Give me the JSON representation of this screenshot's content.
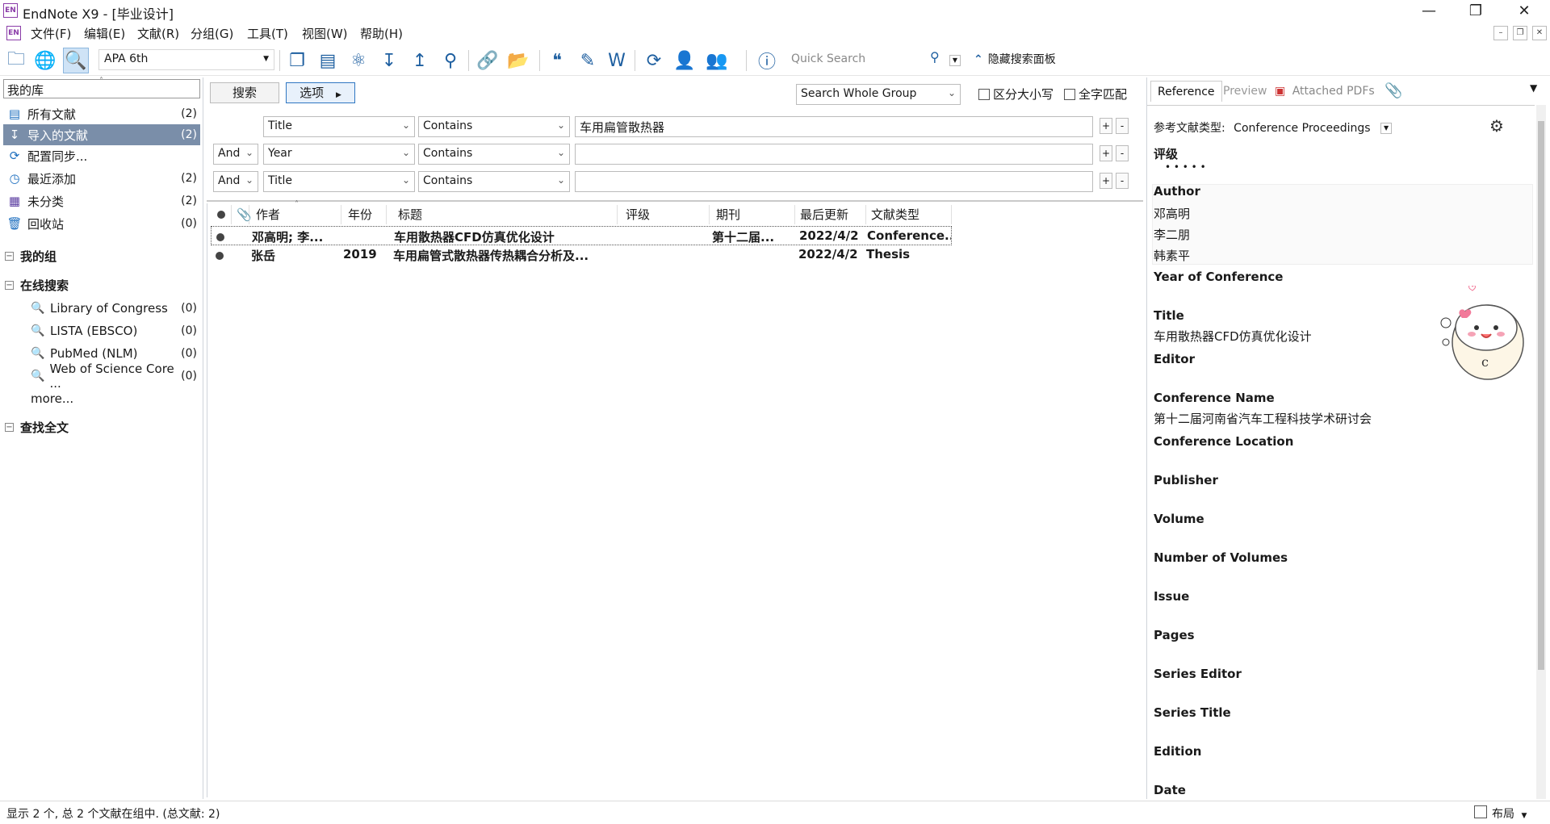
{
  "window": {
    "app_icon": "EN",
    "title": "EndNote X9 - [毕业设计]"
  },
  "menu": [
    "文件(F)",
    "编辑(E)",
    "文献(R)",
    "分组(G)",
    "工具(T)",
    "视图(W)",
    "帮助(H)"
  ],
  "toolbar": {
    "style": "APA 6th",
    "quick_search_placeholder": "Quick Search",
    "hide_panel": "隐藏搜索面板"
  },
  "library": {
    "header": "我的库",
    "items": [
      {
        "label": "所有文献",
        "count": "(2)",
        "icon": "all-refs-icon"
      },
      {
        "label": "导入的文献",
        "count": "(2)",
        "icon": "imported-icon",
        "selected": true
      },
      {
        "label": "配置同步...",
        "count": "",
        "icon": "sync-icon"
      },
      {
        "label": "最近添加",
        "count": "(2)",
        "icon": "recent-icon"
      },
      {
        "label": "未分类",
        "count": "(2)",
        "icon": "unfiled-icon"
      },
      {
        "label": "回收站",
        "count": "(0)",
        "icon": "trash-icon"
      }
    ],
    "my_groups": "我的组",
    "online_search": "在线搜索",
    "online_items": [
      {
        "label": "Library of Congress",
        "count": "(0)"
      },
      {
        "label": "LISTA (EBSCO)",
        "count": "(0)"
      },
      {
        "label": "PubMed (NLM)",
        "count": "(0)"
      },
      {
        "label": "Web of Science Core ...",
        "count": "(0)"
      }
    ],
    "more": "more...",
    "find_fulltext": "查找全文"
  },
  "search": {
    "search_button": "搜索",
    "options_button": "选项",
    "scope": "Search Whole Group",
    "match_case": "区分大小写",
    "match_words": "全字匹配",
    "rows": [
      {
        "bool": "",
        "field": "Title",
        "op": "Contains",
        "value": "车用扁管散热器"
      },
      {
        "bool": "And",
        "field": "Year",
        "op": "Contains",
        "value": ""
      },
      {
        "bool": "And",
        "field": "Title",
        "op": "Contains",
        "value": ""
      }
    ]
  },
  "reflist": {
    "headers": {
      "author": "作者",
      "year": "年份",
      "title": "标题",
      "rating": "评级",
      "journal": "期刊",
      "updated": "最后更新",
      "type": "文献类型"
    },
    "rows": [
      {
        "author": "邓高明; 李...",
        "year": "",
        "title": "车用散热器CFD仿真优化设计",
        "rating": "",
        "journal": "第十二届...",
        "updated": "2022/4/2",
        "type": "Conference..."
      },
      {
        "author": "张岳",
        "year": "2019",
        "title": "车用扁管式散热器传热耦合分析及...",
        "rating": "",
        "journal": "",
        "updated": "2022/4/2",
        "type": "Thesis"
      }
    ]
  },
  "reference": {
    "tabs": [
      "Reference",
      "Preview",
      "Attached PDFs"
    ],
    "type_label": "参考文献类型:",
    "type_value": "Conference Proceedings",
    "rating_label": "评级",
    "rating_dots": "•   •   •   •   •",
    "author_label": "Author",
    "authors": [
      "邓高明",
      "李二朋",
      "韩素平"
    ],
    "fields": [
      {
        "label": "Year of Conference",
        "value": ""
      },
      {
        "label": "Title",
        "value": "车用散热器CFD仿真优化设计"
      },
      {
        "label": "Editor",
        "value": ""
      },
      {
        "label": "Conference Name",
        "value": "第十二届河南省汽车工程科技学术研讨会"
      },
      {
        "label": "Conference Location",
        "value": ""
      },
      {
        "label": "Publisher",
        "value": ""
      },
      {
        "label": "Volume",
        "value": ""
      },
      {
        "label": "Number of Volumes",
        "value": ""
      },
      {
        "label": "Issue",
        "value": ""
      },
      {
        "label": "Pages",
        "value": ""
      },
      {
        "label": "Series Editor",
        "value": ""
      },
      {
        "label": "Series Title",
        "value": ""
      },
      {
        "label": "Edition",
        "value": ""
      },
      {
        "label": "Date",
        "value": ""
      }
    ]
  },
  "status": {
    "text": "显示 2 个, 总 2 个文献在组中. (总文献: 2)",
    "layout": "布局"
  }
}
